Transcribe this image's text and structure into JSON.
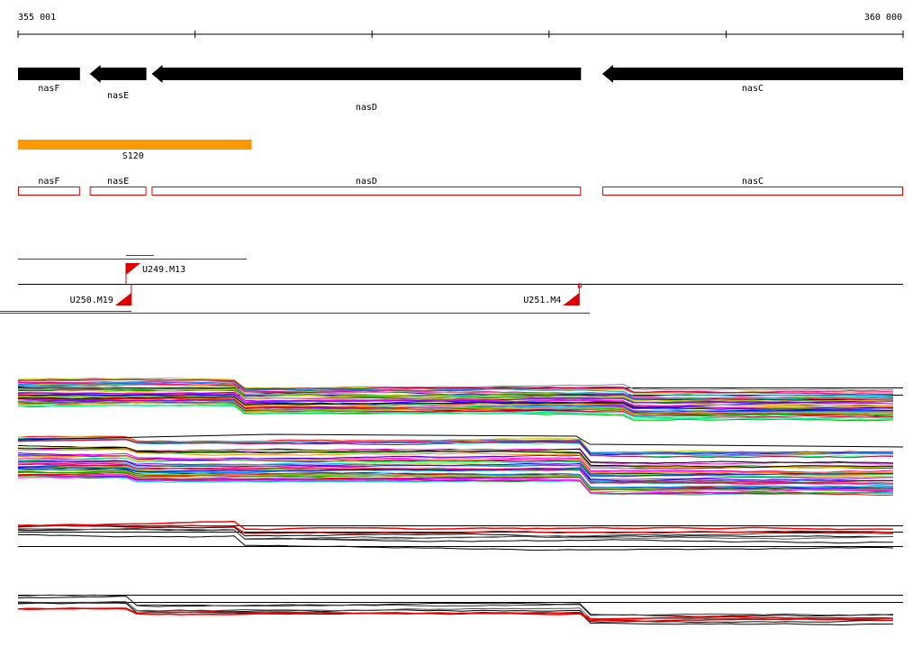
{
  "ruler": {
    "start_label": "355 001",
    "end_label": "360 000",
    "start": 355001,
    "end": 360000
  },
  "genes": [
    {
      "name": "nasF",
      "start": 355001,
      "end": 355351,
      "strand": "+"
    },
    {
      "name": "nasE",
      "start": 355406,
      "end": 355726,
      "strand": "-"
    },
    {
      "name": "nasD",
      "start": 355756,
      "end": 358181,
      "strand": "-"
    },
    {
      "name": "nasC",
      "start": 358301,
      "end": 360000,
      "strand": "-"
    }
  ],
  "region": {
    "name": "S120",
    "start": 355001,
    "end": 356321,
    "color": "#ff9900"
  },
  "cds_boxes": [
    {
      "name": "nasF",
      "start": 355001,
      "end": 355351
    },
    {
      "name": "nasE",
      "start": 355406,
      "end": 355726
    },
    {
      "name": "nasD",
      "start": 355756,
      "end": 358181
    },
    {
      "name": "nasC",
      "start": 358301,
      "end": 360000
    }
  ],
  "transcription_units": [
    {
      "name": "U249.M13",
      "position": 355611
    },
    {
      "name": "U250.M19",
      "position": 355641
    },
    {
      "name": "U251.M4",
      "position": 358171
    }
  ],
  "colors": {
    "gene_arrow": "#000000",
    "cds_outline": "#dd0000",
    "tu_line": "#dd0000",
    "region": "#ff9900"
  }
}
